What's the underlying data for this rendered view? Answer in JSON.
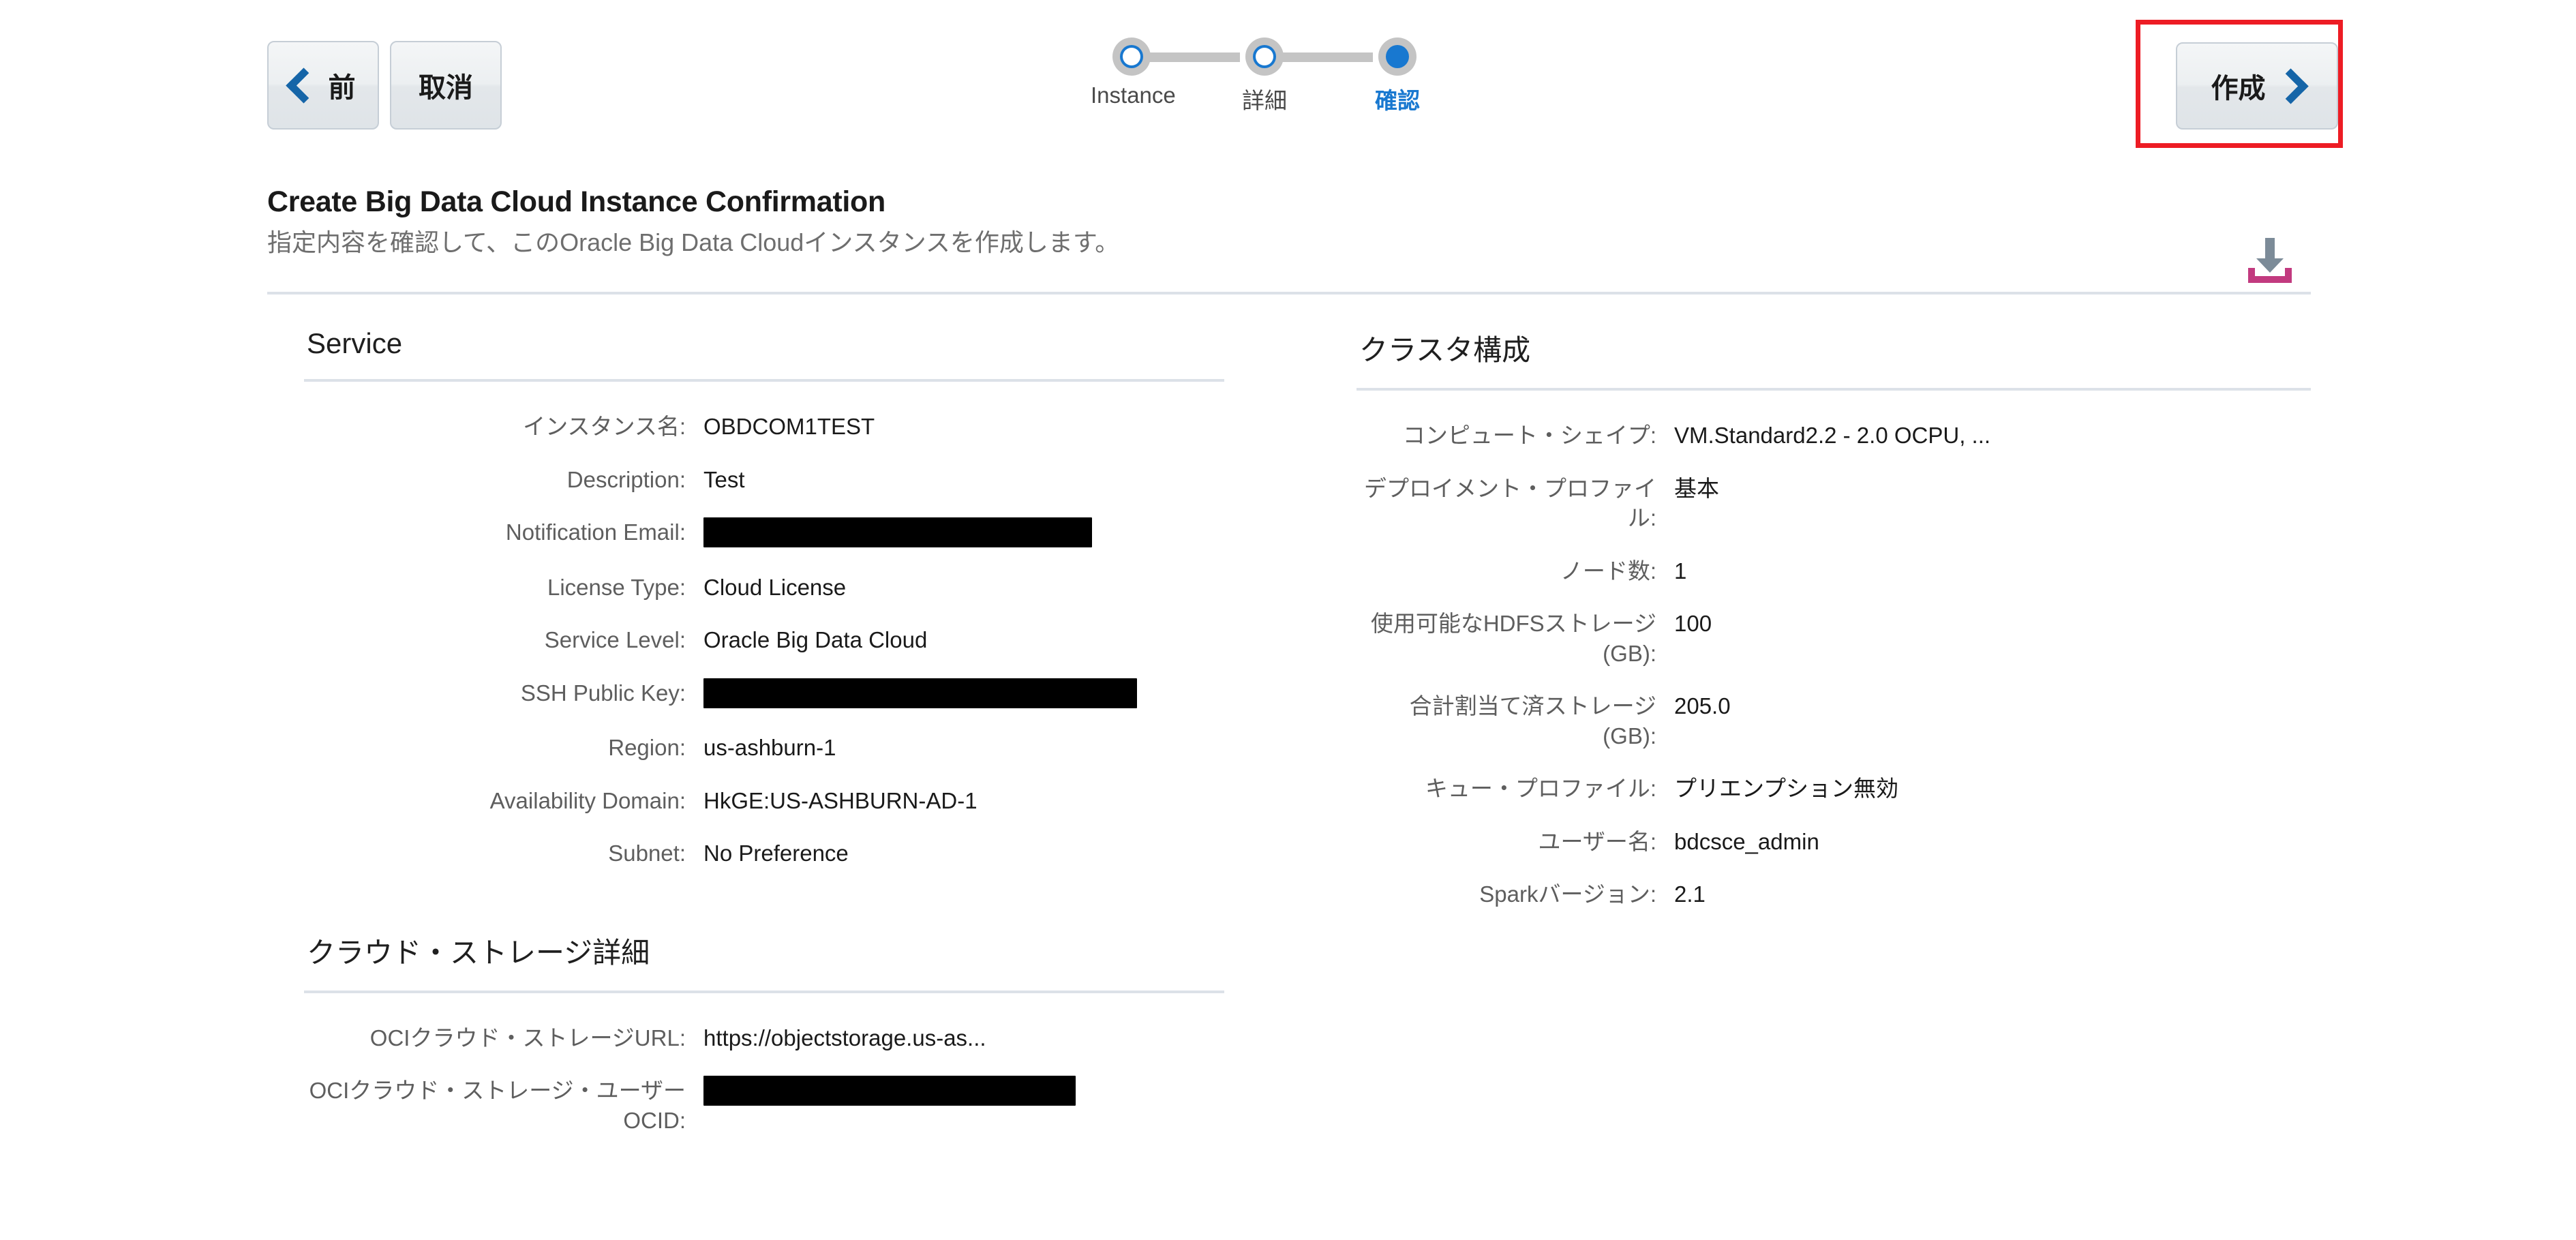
{
  "toolbar": {
    "prev_label": "前",
    "cancel_label": "取消",
    "create_label": "作成",
    "prev_icon": "chevron-left-icon",
    "create_icon": "chevron-right-icon"
  },
  "stepper": {
    "steps": [
      {
        "label": "Instance",
        "state": "incomplete"
      },
      {
        "label": "詳細",
        "state": "incomplete"
      },
      {
        "label": "確認",
        "state": "active"
      }
    ],
    "active_color": "#1878d0",
    "inactive_color": "#c4c4c4"
  },
  "header": {
    "title": "Create Big Data Cloud Instance Confirmation",
    "subtitle": "指定内容を確認して、このOracle Big Data Cloudインスタンスを作成します。",
    "download_icon": "download-icon",
    "download_icon_tray_color": "#c23a7f",
    "download_icon_arrow_color": "#7c8b98"
  },
  "service_section": {
    "title": "Service",
    "rows": [
      {
        "key": "インスタンス名:",
        "value": "OBDCOM1TEST",
        "redacted": false
      },
      {
        "key": "Description:",
        "value": "Test",
        "redacted": false
      },
      {
        "key": "Notification Email:",
        "value": "",
        "redacted": true,
        "redaction": "email"
      },
      {
        "key": "License Type:",
        "value": "Cloud License",
        "redacted": false
      },
      {
        "key": "Service Level:",
        "value": "Oracle Big Data Cloud",
        "redacted": false
      },
      {
        "key": "SSH Public Key:",
        "value": "",
        "redacted": true,
        "redaction": "sshkey"
      },
      {
        "key": "Region:",
        "value": "us-ashburn-1",
        "redacted": false
      },
      {
        "key": "Availability Domain:",
        "value": "HkGE:US-ASHBURN-AD-1",
        "redacted": false
      },
      {
        "key": "Subnet:",
        "value": "No Preference",
        "redacted": false
      }
    ]
  },
  "storage_section": {
    "title": "クラウド・ストレージ詳細",
    "rows": [
      {
        "key": "OCIクラウド・ストレージURL:",
        "value": "https://objectstorage.us-as...",
        "redacted": false
      },
      {
        "key": "OCIクラウド・ストレージ・ユーザーOCID:",
        "value": "",
        "redacted": true,
        "redaction": "ocid"
      }
    ]
  },
  "cluster_section": {
    "title": "クラスタ構成",
    "rows": [
      {
        "key": "コンピュート・シェイプ:",
        "value": "VM.Standard2.2 - 2.0 OCPU, ..."
      },
      {
        "key": "デプロイメント・プロファイル:",
        "value": "基本"
      },
      {
        "key": "ノード数:",
        "value": "1"
      },
      {
        "key": "使用可能なHDFSストレージ(GB):",
        "value": "100"
      },
      {
        "key": "合計割当て済ストレージ(GB):",
        "value": "205.0"
      },
      {
        "key": "キュー・プロファイル:",
        "value": "プリエンプション無効"
      },
      {
        "key": "ユーザー名:",
        "value": "bdcsce_admin"
      },
      {
        "key": "Sparkバージョン:",
        "value": "2.1"
      }
    ]
  },
  "highlight": {
    "target": "create-button",
    "color": "#ED1C24"
  }
}
